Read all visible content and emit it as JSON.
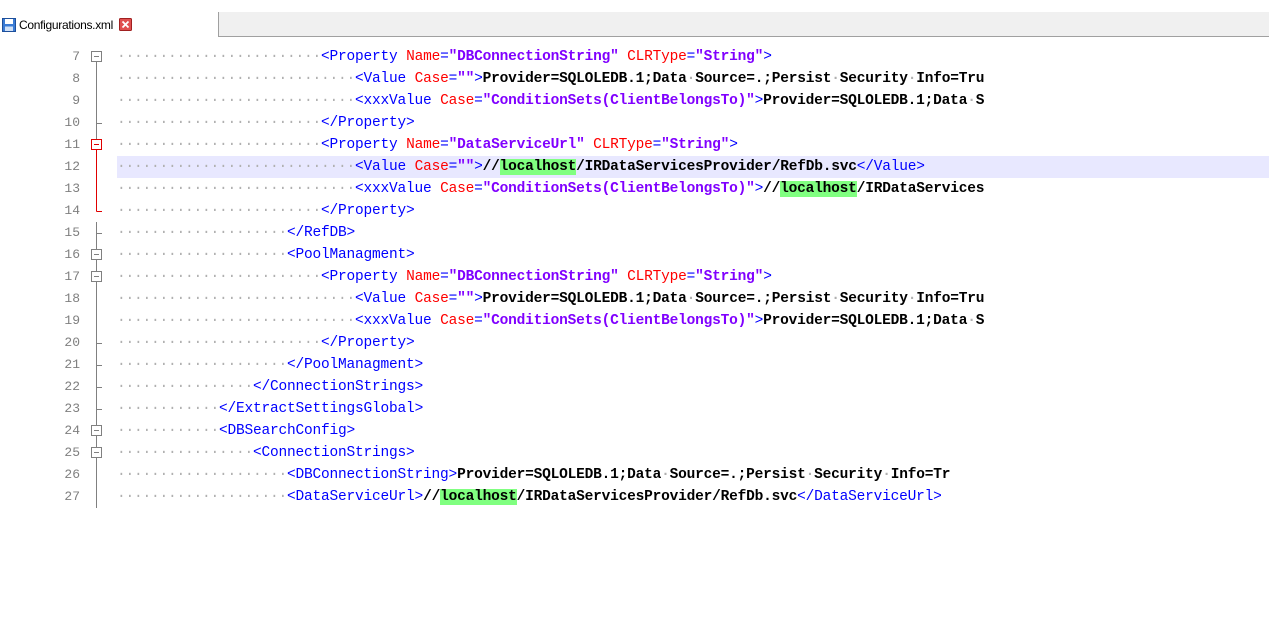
{
  "tab": {
    "filename": "Configurations.xml",
    "icon": "save-icon",
    "close_icon": "close-icon"
  },
  "colors": {
    "tag": "#0000ff",
    "attribute": "#ff0000",
    "value": "#8000ff",
    "text": "#000000",
    "highlight": "#80ff80",
    "current_line": "#e8e8ff"
  },
  "lines": [
    {
      "n": "7",
      "fold": "box-minus",
      "indent": 6,
      "segs": [
        [
          "tag",
          "<Property "
        ],
        [
          "attr",
          "Name"
        ],
        [
          "tag",
          "="
        ],
        [
          "val",
          "\"DBConnectionString\""
        ],
        [
          "tag",
          " "
        ],
        [
          "attr",
          "CLRType"
        ],
        [
          "tag",
          "="
        ],
        [
          "val",
          "\"String\""
        ],
        [
          "tag",
          ">"
        ]
      ]
    },
    {
      "n": "8",
      "fold": "line",
      "indent": 7,
      "segs": [
        [
          "tag",
          "<Value "
        ],
        [
          "attr",
          "Case"
        ],
        [
          "tag",
          "="
        ],
        [
          "val",
          "\"\""
        ],
        [
          "tag",
          ">"
        ],
        [
          "txt",
          "Provider=SQLOLEDB.1;Data Source=.;Persist Security Info=Tru"
        ]
      ]
    },
    {
      "n": "9",
      "fold": "line",
      "indent": 7,
      "segs": [
        [
          "tag",
          "<xxxValue "
        ],
        [
          "attr",
          "Case"
        ],
        [
          "tag",
          "="
        ],
        [
          "val",
          "\"ConditionSets(ClientBelongsTo)\""
        ],
        [
          "tag",
          ">"
        ],
        [
          "txt",
          "Provider=SQLOLEDB.1;Data S"
        ]
      ]
    },
    {
      "n": "10",
      "fold": "end",
      "indent": 6,
      "segs": [
        [
          "tag",
          "</Property>"
        ]
      ]
    },
    {
      "n": "11",
      "fold": "box-minus-red",
      "indent": 6,
      "segs": [
        [
          "tag",
          "<Property "
        ],
        [
          "attr",
          "Name"
        ],
        [
          "tag",
          "="
        ],
        [
          "val",
          "\"DataServiceUrl\""
        ],
        [
          "tag",
          " "
        ],
        [
          "attr",
          "CLRType"
        ],
        [
          "tag",
          "="
        ],
        [
          "val",
          "\"String\""
        ],
        [
          "tag",
          ">"
        ]
      ]
    },
    {
      "n": "12",
      "fold": "line-red",
      "indent": 7,
      "current": true,
      "segs": [
        [
          "tag",
          "<Value "
        ],
        [
          "attr",
          "Case"
        ],
        [
          "tag",
          "="
        ],
        [
          "val",
          "\"\""
        ],
        [
          "tag",
          ">"
        ],
        [
          "txt",
          "//"
        ],
        [
          "mark",
          "localhost"
        ],
        [
          "txt",
          "/IRDataServicesProvider/RefDb.svc"
        ],
        [
          "tag",
          "</Value>"
        ]
      ]
    },
    {
      "n": "13",
      "fold": "line-red",
      "indent": 7,
      "segs": [
        [
          "tag",
          "<xxxValue "
        ],
        [
          "attr",
          "Case"
        ],
        [
          "tag",
          "="
        ],
        [
          "val",
          "\"ConditionSets(ClientBelongsTo)\""
        ],
        [
          "tag",
          ">"
        ],
        [
          "txt",
          "//"
        ],
        [
          "mark",
          "localhost"
        ],
        [
          "txt",
          "/IRDataServices"
        ]
      ]
    },
    {
      "n": "14",
      "fold": "end-red",
      "indent": 6,
      "segs": [
        [
          "tag",
          "</Property>"
        ]
      ]
    },
    {
      "n": "15",
      "fold": "end",
      "indent": 5,
      "segs": [
        [
          "tag",
          "</RefDB>"
        ]
      ]
    },
    {
      "n": "16",
      "fold": "box-minus",
      "indent": 5,
      "segs": [
        [
          "tag",
          "<PoolManagment>"
        ]
      ]
    },
    {
      "n": "17",
      "fold": "box-minus",
      "indent": 6,
      "segs": [
        [
          "tag",
          "<Property "
        ],
        [
          "attr",
          "Name"
        ],
        [
          "tag",
          "="
        ],
        [
          "val",
          "\"DBConnectionString\""
        ],
        [
          "tag",
          " "
        ],
        [
          "attr",
          "CLRType"
        ],
        [
          "tag",
          "="
        ],
        [
          "val",
          "\"String\""
        ],
        [
          "tag",
          ">"
        ]
      ]
    },
    {
      "n": "18",
      "fold": "line",
      "indent": 7,
      "segs": [
        [
          "tag",
          "<Value "
        ],
        [
          "attr",
          "Case"
        ],
        [
          "tag",
          "="
        ],
        [
          "val",
          "\"\""
        ],
        [
          "tag",
          ">"
        ],
        [
          "txt",
          "Provider=SQLOLEDB.1;Data Source=.;Persist Security Info=Tru"
        ]
      ]
    },
    {
      "n": "19",
      "fold": "line",
      "indent": 7,
      "segs": [
        [
          "tag",
          "<xxxValue "
        ],
        [
          "attr",
          "Case"
        ],
        [
          "tag",
          "="
        ],
        [
          "val",
          "\"ConditionSets(ClientBelongsTo)\""
        ],
        [
          "tag",
          ">"
        ],
        [
          "txt",
          "Provider=SQLOLEDB.1;Data S"
        ]
      ]
    },
    {
      "n": "20",
      "fold": "end",
      "indent": 6,
      "segs": [
        [
          "tag",
          "</Property>"
        ]
      ]
    },
    {
      "n": "21",
      "fold": "end",
      "indent": 5,
      "segs": [
        [
          "tag",
          "</PoolManagment>"
        ]
      ]
    },
    {
      "n": "22",
      "fold": "end",
      "indent": 4,
      "segs": [
        [
          "tag",
          "</ConnectionStrings>"
        ]
      ]
    },
    {
      "n": "23",
      "fold": "end",
      "indent": 3,
      "segs": [
        [
          "tag",
          "</ExtractSettingsGlobal>"
        ]
      ]
    },
    {
      "n": "24",
      "fold": "box-minus",
      "indent": 3,
      "segs": [
        [
          "tag",
          "<DBSearchConfig>"
        ]
      ]
    },
    {
      "n": "25",
      "fold": "box-minus",
      "indent": 4,
      "segs": [
        [
          "tag",
          "<ConnectionStrings>"
        ]
      ]
    },
    {
      "n": "26",
      "fold": "line",
      "indent": 5,
      "segs": [
        [
          "tag",
          "<DBConnectionString>"
        ],
        [
          "txt",
          "Provider=SQLOLEDB.1;Data Source=.;Persist Security Info=Tr"
        ]
      ]
    },
    {
      "n": "27",
      "fold": "line",
      "indent": 5,
      "segs": [
        [
          "tag",
          "<DataServiceUrl>"
        ],
        [
          "txt",
          "//"
        ],
        [
          "mark",
          "localhost"
        ],
        [
          "txt",
          "/IRDataServicesProvider/RefDb.svc"
        ],
        [
          "tag",
          "</DataServiceUrl>"
        ]
      ]
    }
  ]
}
